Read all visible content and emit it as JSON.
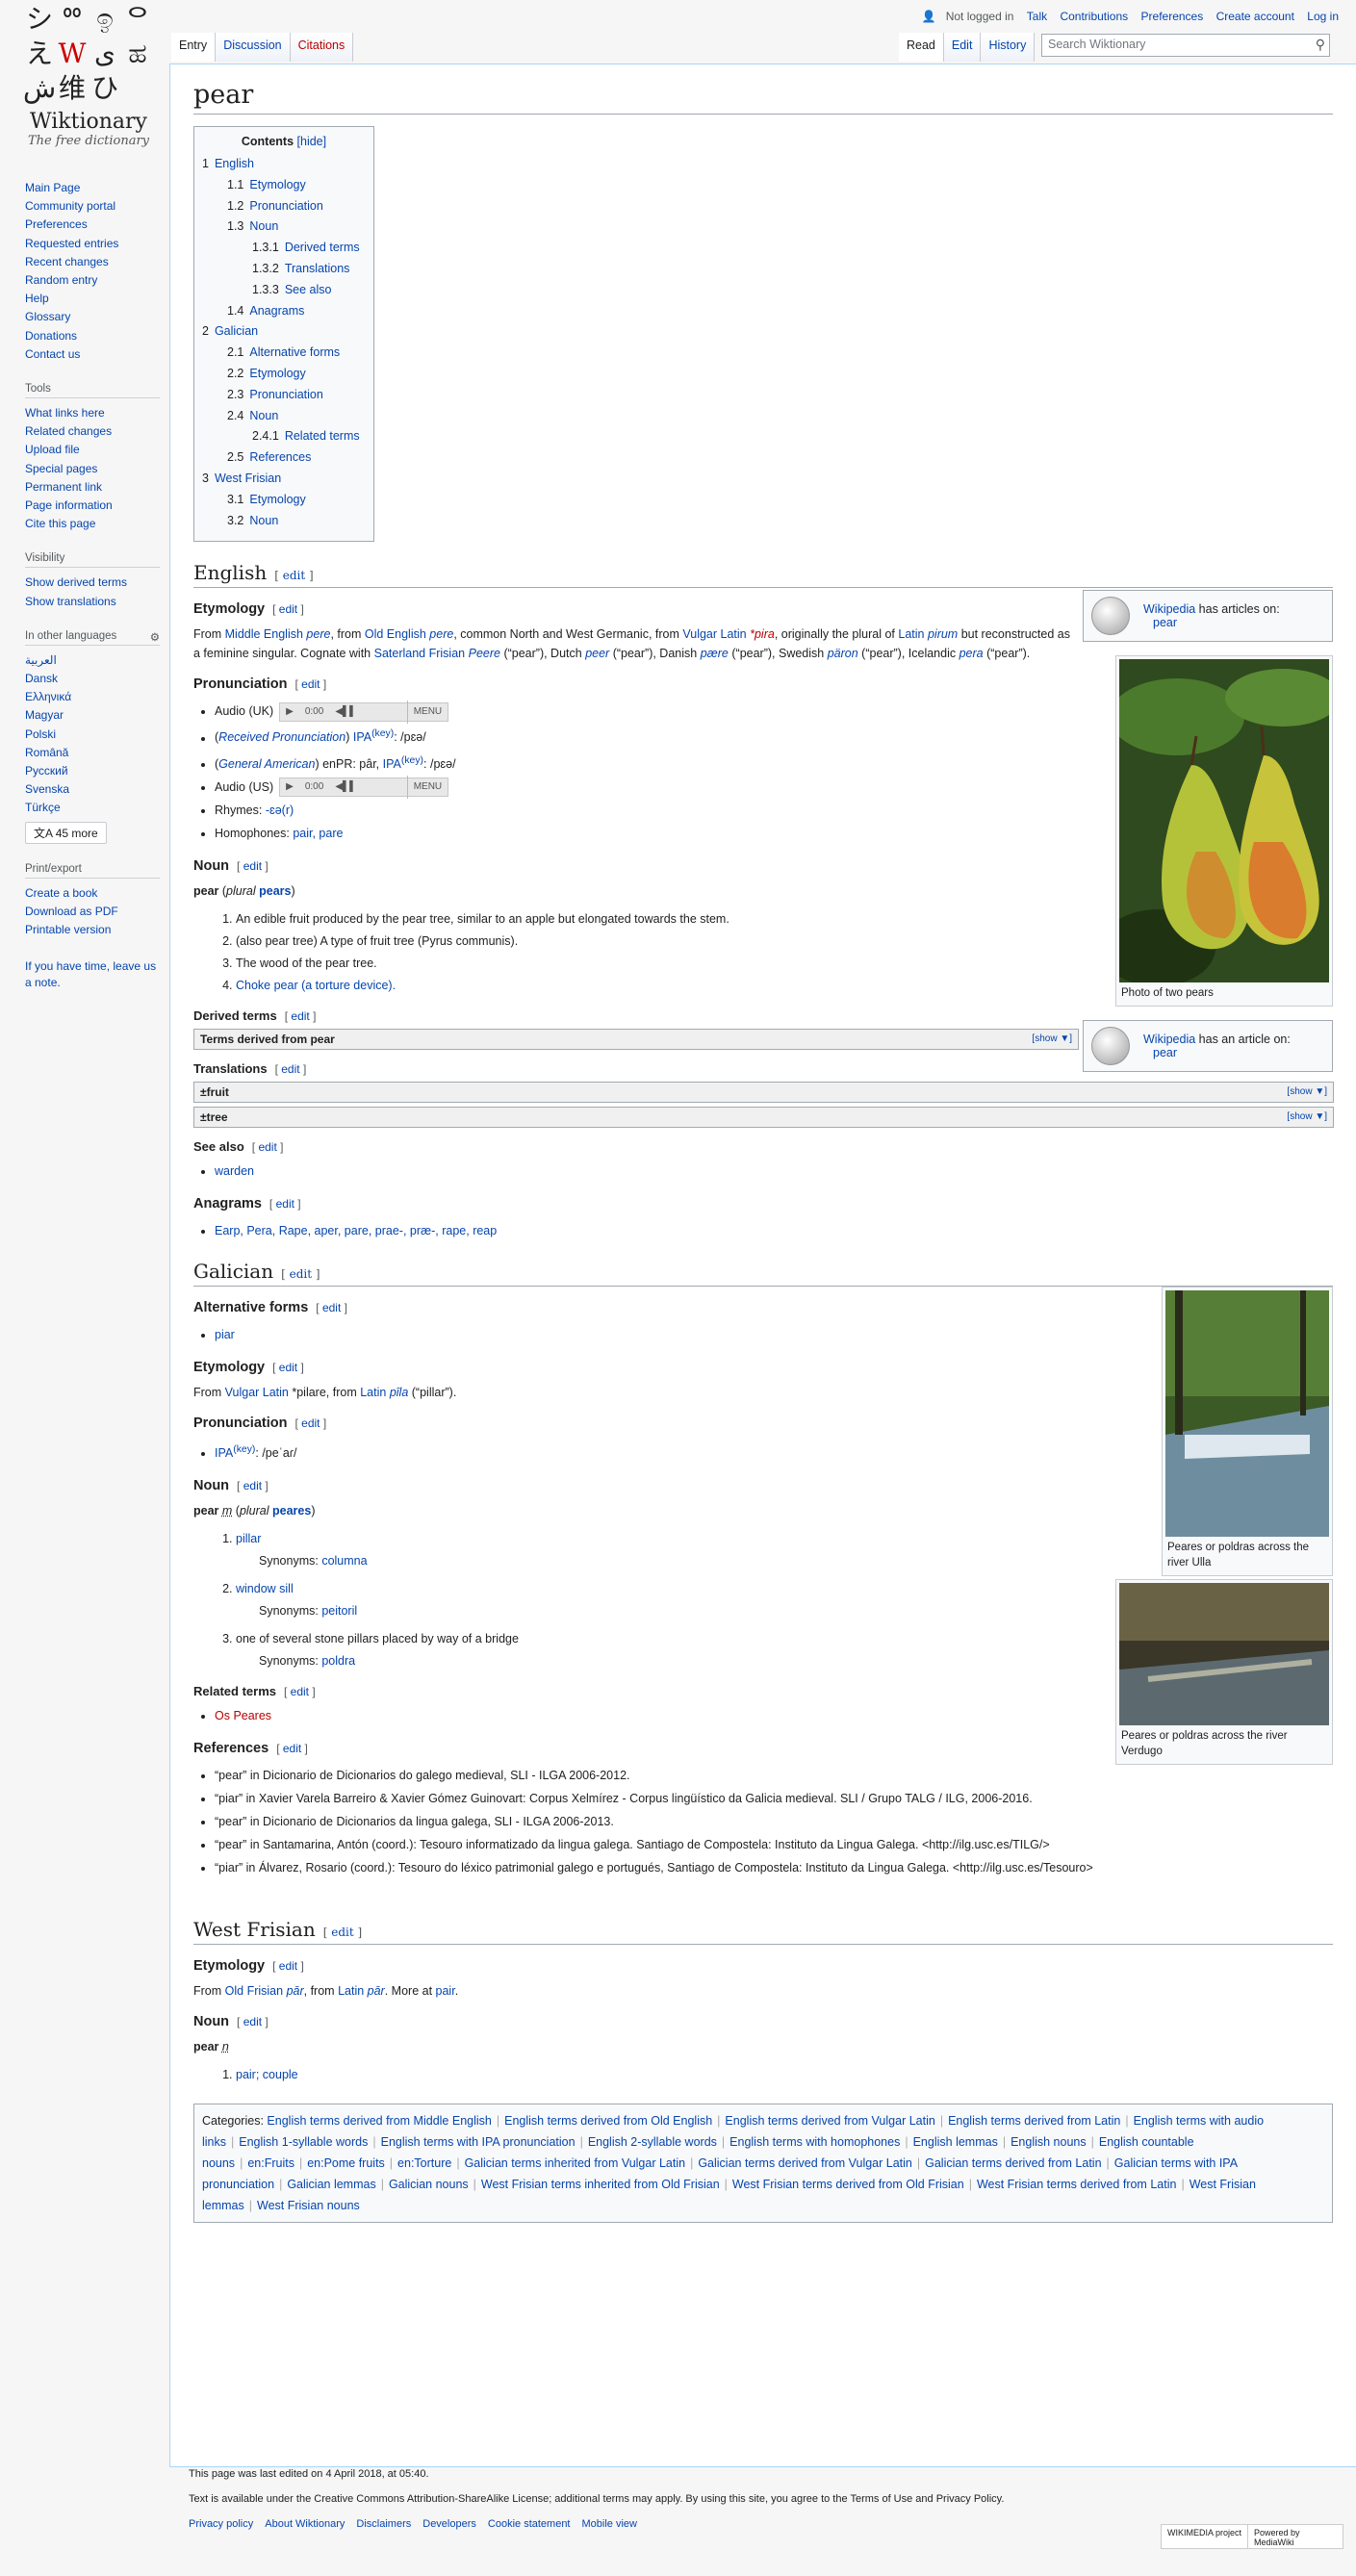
{
  "logo": {
    "glyphs": [
      "シ",
      "ᅇ",
      "ඉ",
      "ᄋ",
      "え",
      "W",
      "ی",
      "ಹ",
      "ش",
      "维",
      "ひ"
    ],
    "name": "Wiktionary",
    "tagline": "The free dictionary"
  },
  "personal": {
    "not_logged": "Not logged in",
    "links": [
      "Talk",
      "Contributions",
      "Preferences",
      "Create account",
      "Log in"
    ]
  },
  "tabs_left": [
    "Entry",
    "Discussion",
    "Citations"
  ],
  "tabs_right": [
    "Read",
    "Edit",
    "History"
  ],
  "search": {
    "placeholder": "Search Wiktionary"
  },
  "sidebar": {
    "main": [
      "Main Page",
      "Community portal",
      "Preferences",
      "Requested entries",
      "Recent changes",
      "Random entry",
      "Help",
      "Glossary",
      "Donations",
      "Contact us"
    ],
    "tools_title": "Tools",
    "tools": [
      "What links here",
      "Related changes",
      "Upload file",
      "Special pages",
      "Permanent link",
      "Page information",
      "Cite this page"
    ],
    "visibility_title": "Visibility",
    "visibility": [
      "Show derived terms",
      "Show translations"
    ],
    "languages_title": "In other languages",
    "languages": [
      "العربية",
      "Dansk",
      "Ελληνικά",
      "Magyar",
      "Polski",
      "Română",
      "Русский",
      "Svenska",
      "Türkçe"
    ],
    "more_langs": "45 more",
    "print_title": "Print/export",
    "print": [
      "Create a book",
      "Download as PDF",
      "Printable version"
    ],
    "note": "If you have time, leave us a note."
  },
  "title": "pear",
  "toc": {
    "title": "Contents",
    "hide": "[hide]",
    "items": [
      {
        "n": "1",
        "t": "English",
        "l": 1
      },
      {
        "n": "1.1",
        "t": "Etymology",
        "l": 2
      },
      {
        "n": "1.2",
        "t": "Pronunciation",
        "l": 2
      },
      {
        "n": "1.3",
        "t": "Noun",
        "l": 2
      },
      {
        "n": "1.3.1",
        "t": "Derived terms",
        "l": 3
      },
      {
        "n": "1.3.2",
        "t": "Translations",
        "l": 3
      },
      {
        "n": "1.3.3",
        "t": "See also",
        "l": 3
      },
      {
        "n": "1.4",
        "t": "Anagrams",
        "l": 2
      },
      {
        "n": "2",
        "t": "Galician",
        "l": 1
      },
      {
        "n": "2.1",
        "t": "Alternative forms",
        "l": 2
      },
      {
        "n": "2.2",
        "t": "Etymology",
        "l": 2
      },
      {
        "n": "2.3",
        "t": "Pronunciation",
        "l": 2
      },
      {
        "n": "2.4",
        "t": "Noun",
        "l": 2
      },
      {
        "n": "2.4.1",
        "t": "Related terms",
        "l": 3
      },
      {
        "n": "2.5",
        "t": "References",
        "l": 2
      },
      {
        "n": "3",
        "t": "West Frisian",
        "l": 1
      },
      {
        "n": "3.1",
        "t": "Etymology",
        "l": 2
      },
      {
        "n": "3.2",
        "t": "Noun",
        "l": 2
      }
    ]
  },
  "edit_label": "edit",
  "english": {
    "heading": "English",
    "etym_h": "Etymology",
    "etym_text": [
      "From ",
      "Middle English",
      " ",
      "pere",
      ", from ",
      "Old English",
      " ",
      "pere",
      ", common North and West Germanic, from ",
      "Vulgar Latin",
      " ",
      "*pira",
      ", originally the plural of ",
      "Latin",
      " ",
      "pirum",
      " but reconstructed as a feminine singular. Cognate with ",
      "Saterland Frisian",
      " ",
      "Peere",
      " (“pear”), Dutch ",
      "peer",
      " (“pear”), Danish ",
      "pære",
      " (“pear”), Swedish ",
      "päron",
      " (“pear”), Icelandic ",
      "pera",
      " (“pear”)."
    ],
    "pron_h": "Pronunciation",
    "audio_uk": "Audio (UK)",
    "audio_time": "0:00",
    "audio_menu": "MENU",
    "rp": "Received Pronunciation",
    "ipa_rp": "/pɛə/",
    "ga": "General American",
    "enpr": "enPR: pâr,",
    "ipa_ga": "/pɛə/",
    "audio_us": "Audio (US)",
    "rhymes_label": "Rhymes:",
    "rhymes": "-ɛə(r)",
    "homophones_label": "Homophones:",
    "homophones": "pair, pare",
    "noun_h": "Noun",
    "headword": "pear",
    "plural_label": "plural",
    "plural": "pears",
    "defs": [
      "An edible fruit produced by the pear tree, similar to an apple but elongated towards the stem.",
      "(also pear tree) A type of fruit tree (Pyrus communis).",
      "The wood of the pear tree.",
      "Choke pear (a torture device)."
    ],
    "derived_h": "Derived terms",
    "derived_box": "Terms derived from pear",
    "show": "[show ▼]",
    "trans_h": "Translations",
    "trans_fruit": "±fruit",
    "trans_tree": "±tree",
    "see_h": "See also",
    "see": "warden",
    "anag_h": "Anagrams",
    "anag": "Earp, Pera, Rape, aper, pare, prae-, præ-, rape, reap",
    "wp1_pre": "Wikipedia",
    "wp1_mid": " has articles on:",
    "wp1_link": "pear",
    "photo_cap": "Photo of two pears",
    "wp2_mid": " has an article on:",
    "wp2_link": "pear"
  },
  "galician": {
    "heading": "Galician",
    "alt_h": "Alternative forms",
    "alt": "piar",
    "etym_h": "Etymology",
    "etym": [
      "From ",
      "Vulgar Latin",
      " *pilare, from ",
      "Latin",
      " ",
      "pīla",
      " (“pillar”)."
    ],
    "pron_h": "Pronunciation",
    "ipa": "/peˈaɾ/",
    "noun_h": "Noun",
    "headword": "pear",
    "gender": "m",
    "plural": "peares",
    "defs": [
      {
        "t": "pillar",
        "syn": "columna"
      },
      {
        "t": "window sill",
        "syn": "peitoril"
      },
      {
        "t": "one of several stone pillars placed by way of a bridge",
        "syn": "poldra"
      }
    ],
    "syn_label": "Synonyms:",
    "rel_h": "Related terms",
    "rel": "Os Peares",
    "ref_h": "References",
    "refs": [
      "“pear” in Dicionario de Dicionarios do galego medieval, SLI - ILGA 2006-2012.",
      "“piar” in Xavier Varela Barreiro & Xavier Gómez Guinovart: Corpus Xelmírez - Corpus lingüístico da Galicia medieval. SLI / Grupo TALG / ILG, 2006-2016.",
      "“pear” in Dicionario de Dicionarios da lingua galega, SLI - ILGA 2006-2013.",
      "“pear” in Santamarina, Antón (coord.): Tesouro informatizado da lingua galega. Santiago de Compostela: Instituto da Lingua Galega. <http://ilg.usc.es/TILG/>",
      "“piar” in Álvarez, Rosario (coord.): Tesouro do léxico patrimonial galego e portugués, Santiago de Compostela: Instituto da Lingua Galega. <http://ilg.usc.es/Tesouro>"
    ],
    "cap1": "Peares or poldras across the river Ulla",
    "cap2": "Peares or poldras across the river Verdugo"
  },
  "frisian": {
    "heading": "West Frisian",
    "etym_h": "Etymology",
    "etym": [
      "From ",
      "Old Frisian",
      " ",
      "pār",
      ", from ",
      "Latin",
      " ",
      "pār",
      ". More at ",
      "pair",
      "."
    ],
    "noun_h": "Noun",
    "headword": "pear",
    "gender": "n",
    "def": "pair; couple"
  },
  "categories": {
    "label": "Categories:",
    "items": [
      "English terms derived from Middle English",
      "English terms derived from Old English",
      "English terms derived from Vulgar Latin",
      "English terms derived from Latin",
      "English terms with audio links",
      "English 1-syllable words",
      "English terms with IPA pronunciation",
      "English 2-syllable words",
      "English terms with homophones",
      "English lemmas",
      "English nouns",
      "English countable nouns",
      "en:Fruits",
      "en:Pome fruits",
      "en:Torture",
      "Galician terms inherited from Vulgar Latin",
      "Galician terms derived from Vulgar Latin",
      "Galician terms derived from Latin",
      "Galician terms with IPA pronunciation",
      "Galician lemmas",
      "Galician nouns",
      "West Frisian terms inherited from Old Frisian",
      "West Frisian terms derived from Old Frisian",
      "West Frisian terms derived from Latin",
      "West Frisian lemmas",
      "West Frisian nouns"
    ]
  },
  "footer": {
    "edited": "This page was last edited on 4 April 2018, at 05:40.",
    "license": "Text is available under the Creative Commons Attribution-ShareAlike License; additional terms may apply. By using this site, you agree to the Terms of Use and Privacy Policy.",
    "links": [
      "Privacy policy",
      "About Wiktionary",
      "Disclaimers",
      "Developers",
      "Cookie statement",
      "Mobile view"
    ],
    "badge1": "WIKIMEDIA project",
    "badge2": "Powered by MediaWiki"
  }
}
